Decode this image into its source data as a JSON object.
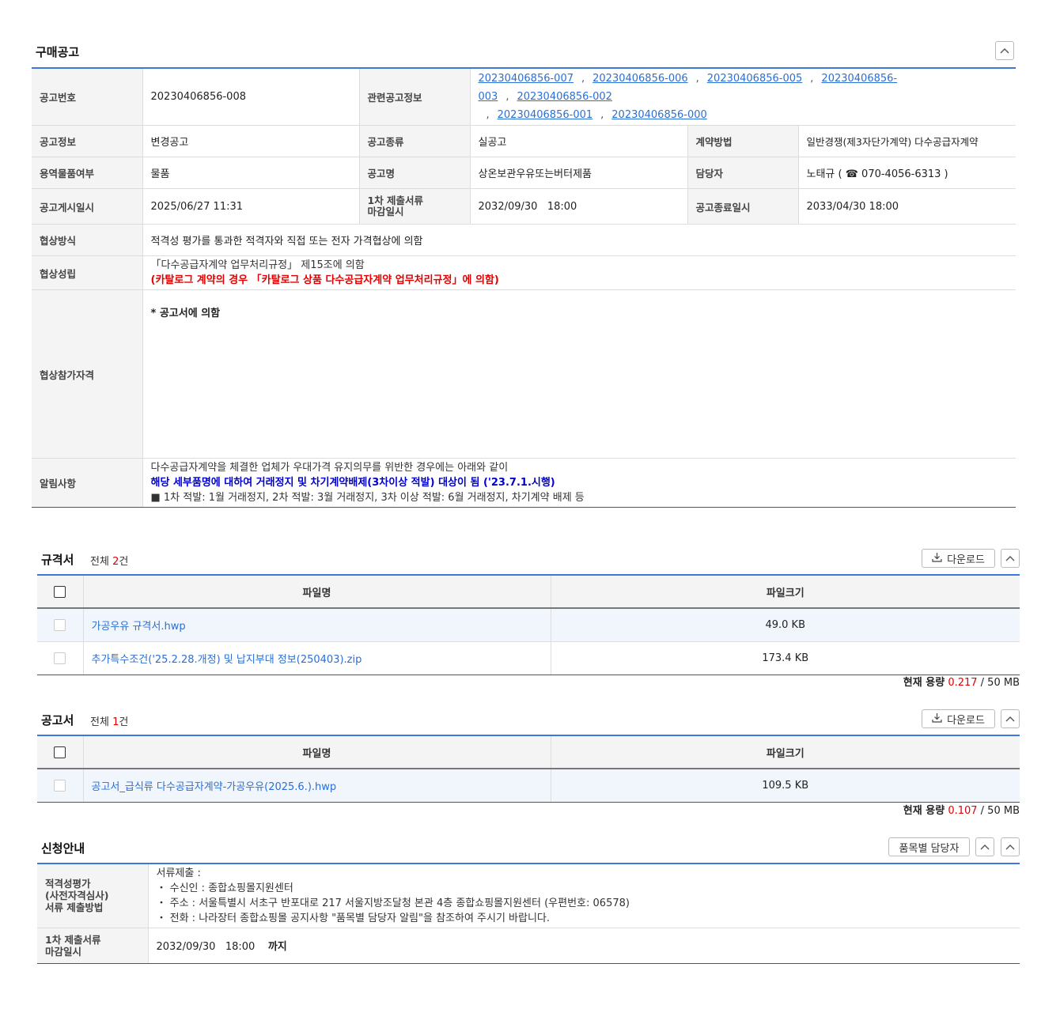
{
  "notice": {
    "title": "구매공고",
    "rows": {
      "notice_no_label": "공고번호",
      "notice_no": "20230406856-008",
      "related_label": "관련공고정보",
      "related_links": [
        "20230406856-007",
        "20230406856-006",
        "20230406856-005",
        "20230406856-003",
        "20230406856-002",
        "20230406856-001",
        "20230406856-000"
      ],
      "link_sep": ",",
      "info_label": "공고정보",
      "info": "변경공고",
      "kind_label": "공고종류",
      "kind": "실공고",
      "method_label": "계약방법",
      "method": "일반경쟁(제3자단가계약) 다수공급자계약",
      "type_label": "용역물품여부",
      "type": "물품",
      "name_label": "공고명",
      "name": "상온보관우유또는버터제품",
      "manager_label": "담당자",
      "manager": "노태규 ( ☎ 070-4056-6313 )",
      "posted_label": "공고게시일시",
      "posted": "2025/06/27 11:31",
      "deadline1_label_a": "1차 제출서류",
      "deadline1_label_b": "마감일시",
      "deadline1": "2032/09/30   18:00",
      "end_label": "공고종료일시",
      "end": "2033/04/30 18:00",
      "nego_label": "협상방식",
      "nego": "적격성 평가를 통과한 적격자와 직접 또는 전자 가격협상에 의함",
      "nego_est_label": "협상성립",
      "nego_est_1": "「다수공급자계약 업무처리규정」 제15조에 의함",
      "nego_est_2": "(카탈로그 계약의 경우 「카탈로그 상품 다수공급자계약 업무처리규정」에 의함)",
      "qual_label": "협상참가자격",
      "qual": "* 공고서에 의함",
      "alert_label": "알림사항",
      "alert_1": "다수공급자계약을 체결한 업체가 우대가격 유지의무를 위반한 경우에는 아래와 같이",
      "alert_2": "해당 세부품명에 대하여 거래정지 및 차기계약배제(3차이상 적발) 대상이 됨 ('23.7.1.시행)",
      "alert_3": "■ 1차 적발: 1월 거래정지, 2차 적발: 3월 거래정지, 3차 이상 적발: 6월 거래정지, 차기계약 배제 등"
    }
  },
  "spec": {
    "title": "규격서",
    "count_prefix": "전체 ",
    "count": "2",
    "count_suffix": "건",
    "download": "다운로드",
    "col_name": "파일명",
    "col_size": "파일크기",
    "files": [
      {
        "name": "가공우유 규격서.hwp",
        "size": "49.0 KB"
      },
      {
        "name": "추가특수조건('25.2.28.개정) 및 납지부대 정보(250403).zip",
        "size": "173.4 KB"
      }
    ],
    "usage_label": "현재 용량",
    "usage": "0.217",
    "usage_total": " / 50 MB"
  },
  "doc": {
    "title": "공고서",
    "count_prefix": "전체 ",
    "count": "1",
    "count_suffix": "건",
    "download": "다운로드",
    "col_name": "파일명",
    "col_size": "파일크기",
    "files": [
      {
        "name": "공고서_급식류 다수공급자계약-가공우유(2025.6.).hwp",
        "size": "109.5 KB"
      }
    ],
    "usage_label": "현재 용량",
    "usage": "0.107",
    "usage_total": " / 50 MB"
  },
  "apply": {
    "title": "신청안내",
    "manager_btn": "품목별 담당자",
    "method_label_1": "적격성평가",
    "method_label_2": "(사전자격심사)",
    "method_label_3": "서류 제출방법",
    "method_1": "서류제출 :",
    "method_2": "・ 수신인 : 종합쇼핑몰지원센터",
    "method_3": "・ 주소 : 서울특별시 서초구 반포대로 217 서울지방조달청 본관 4층 종합쇼핑몰지원센터 (우편번호: 06578)",
    "method_4": "・ 전화 : 나라장터 종합쇼핑몰 공지사항 \"품목별 담당자 알림\"을 참조하여 주시기 바랍니다.",
    "deadline_label_1": "1차 제출서류",
    "deadline_label_2": "마감일시",
    "deadline": "2032/09/30   18:00",
    "deadline_suffix": "까지"
  }
}
